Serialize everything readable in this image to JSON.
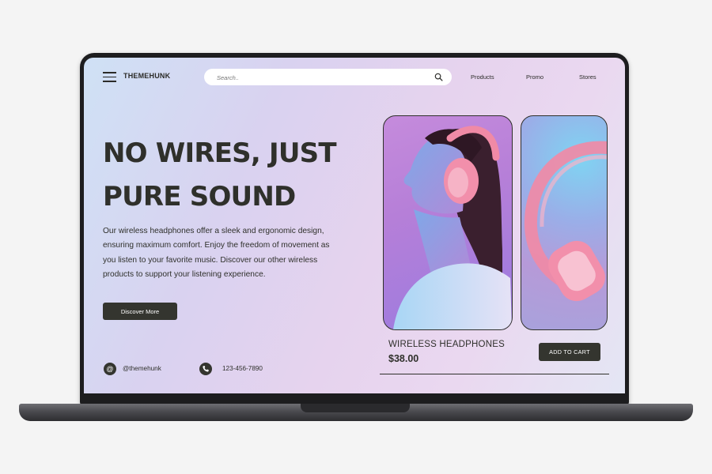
{
  "nav": {
    "brand": "THEMEHUNK",
    "search_placeholder": "Search..",
    "links": [
      "Products",
      "Promo",
      "Stores"
    ]
  },
  "hero": {
    "title_lines": [
      "NO WIRES, JUST",
      "PURE SOUND"
    ],
    "description": "Our wireless headphones offer a sleek and ergonomic design, ensuring maximum comfort. Enjoy the freedom of movement as you listen to your favorite music. Discover our other wireless products to support your listening experience.",
    "cta_label": "Discover More"
  },
  "contact": {
    "social_handle": "@themehunk",
    "phone": "123-456-7890"
  },
  "product": {
    "name": "WIRELESS HEADPHONES",
    "price": "$38.00",
    "cart_label": "ADD TO CART"
  },
  "colors": {
    "text_dark": "#2f302b",
    "button_bg": "#34352f",
    "headphone_pink": "#f08aa6"
  },
  "icons": [
    "menu-icon",
    "search-icon",
    "at-sign-icon",
    "phone-icon"
  ]
}
